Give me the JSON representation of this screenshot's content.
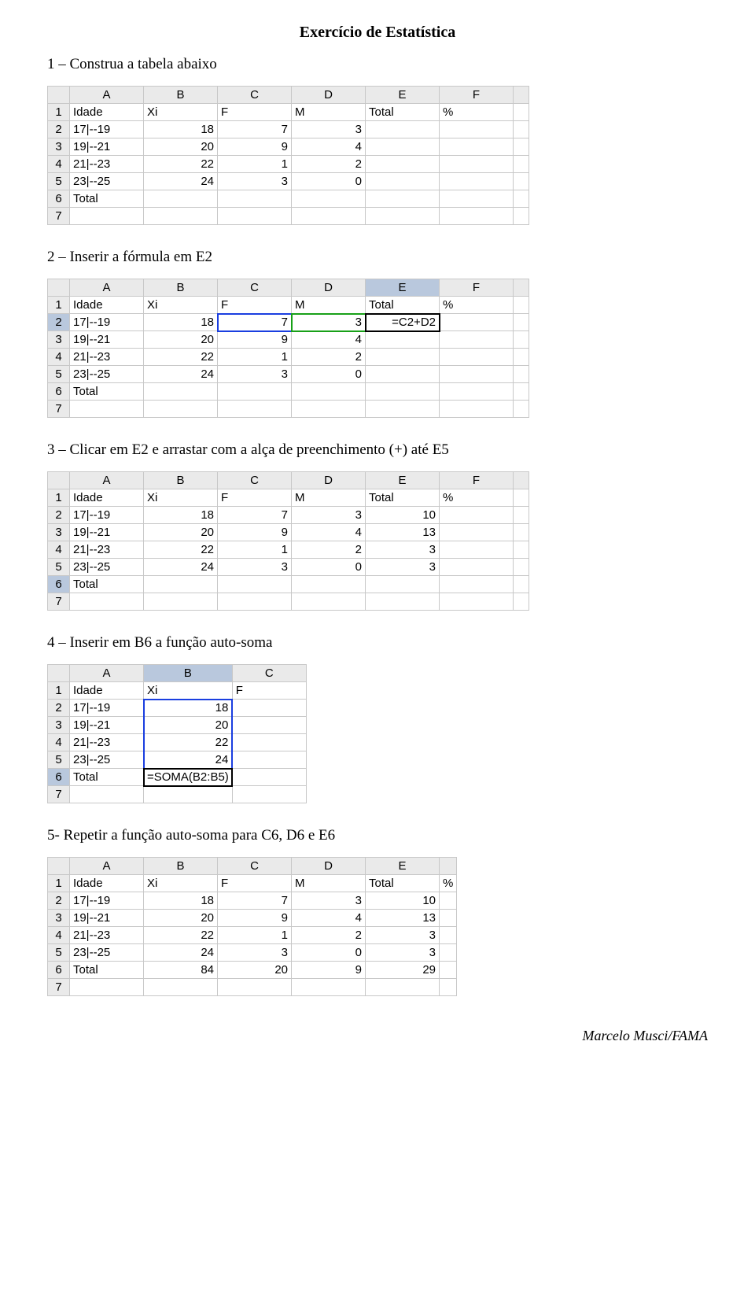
{
  "title": "Exercício de Estatística",
  "steps": {
    "s1": "1 – Construa a tabela abaixo",
    "s2": "2 – Inserir a fórmula em E2",
    "s3": "3 – Clicar em E2 e arrastar com a alça de preenchimento (+) até E5",
    "s4": "4 – Inserir em B6 a função auto-soma",
    "s5": "5- Repetir a função auto-soma para C6, D6 e E6"
  },
  "cols6": [
    "A",
    "B",
    "C",
    "D",
    "E",
    "F"
  ],
  "cols3": [
    "A",
    "B",
    "C"
  ],
  "cols5p": [
    "A",
    "B",
    "C",
    "D",
    "E"
  ],
  "rows": [
    "1",
    "2",
    "3",
    "4",
    "5",
    "6",
    "7"
  ],
  "t1": {
    "r1": [
      "Idade",
      "Xi",
      "F",
      "M",
      "Total",
      "%"
    ],
    "r2": [
      "17|--19",
      "18",
      "7",
      "3",
      "",
      ""
    ],
    "r3": [
      "19|--21",
      "20",
      "9",
      "4",
      "",
      ""
    ],
    "r4": [
      "21|--23",
      "22",
      "1",
      "2",
      "",
      ""
    ],
    "r5": [
      "23|--25",
      "24",
      "3",
      "0",
      "",
      ""
    ],
    "r6": [
      "Total",
      "",
      "",
      "",
      "",
      ""
    ]
  },
  "t2": {
    "r1": [
      "Idade",
      "Xi",
      "F",
      "M",
      "Total",
      "%"
    ],
    "r2": [
      "17|--19",
      "18",
      "7",
      "3",
      "=C2+D2",
      ""
    ],
    "r3": [
      "19|--21",
      "20",
      "9",
      "4",
      "",
      ""
    ],
    "r4": [
      "21|--23",
      "22",
      "1",
      "2",
      "",
      ""
    ],
    "r5": [
      "23|--25",
      "24",
      "3",
      "0",
      "",
      ""
    ],
    "r6": [
      "Total",
      "",
      "",
      "",
      "",
      ""
    ]
  },
  "t3": {
    "r1": [
      "Idade",
      "Xi",
      "F",
      "M",
      "Total",
      "%"
    ],
    "r2": [
      "17|--19",
      "18",
      "7",
      "3",
      "10",
      ""
    ],
    "r3": [
      "19|--21",
      "20",
      "9",
      "4",
      "13",
      ""
    ],
    "r4": [
      "21|--23",
      "22",
      "1",
      "2",
      "3",
      ""
    ],
    "r5": [
      "23|--25",
      "24",
      "3",
      "0",
      "3",
      ""
    ],
    "r6": [
      "Total",
      "",
      "",
      "",
      "",
      ""
    ]
  },
  "t4": {
    "r1": [
      "Idade",
      "Xi",
      "F"
    ],
    "r2": [
      "17|--19",
      "18",
      ""
    ],
    "r3": [
      "19|--21",
      "20",
      ""
    ],
    "r4": [
      "21|--23",
      "22",
      ""
    ],
    "r5": [
      "23|--25",
      "24",
      ""
    ],
    "r6": [
      "Total",
      "=SOMA(B2:B5)",
      ""
    ]
  },
  "t5": {
    "r1": [
      "Idade",
      "Xi",
      "F",
      "M",
      "Total",
      "%"
    ],
    "r2": [
      "17|--19",
      "18",
      "7",
      "3",
      "10",
      ""
    ],
    "r3": [
      "19|--21",
      "20",
      "9",
      "4",
      "13",
      ""
    ],
    "r4": [
      "21|--23",
      "22",
      "1",
      "2",
      "3",
      ""
    ],
    "r5": [
      "23|--25",
      "24",
      "3",
      "0",
      "3",
      ""
    ],
    "r6": [
      "Total",
      "84",
      "20",
      "9",
      "29",
      ""
    ]
  },
  "footer": "Marcelo Musci/FAMA"
}
